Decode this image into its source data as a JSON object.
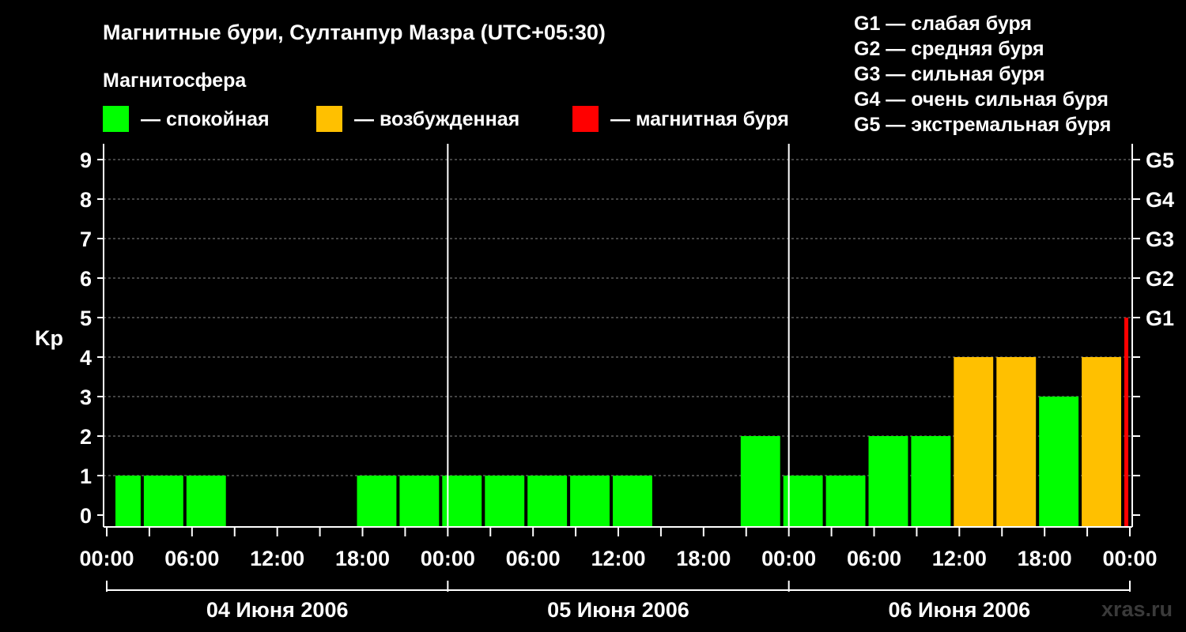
{
  "chart_data": {
    "type": "bar",
    "title": "Магнитные бури, Султанпур Мазра (UTC+05:30)",
    "ylabel": "Kp",
    "ylim": [
      0,
      9
    ],
    "yticks": [
      "0",
      "1",
      "2",
      "3",
      "4",
      "5",
      "6",
      "7",
      "8",
      "9"
    ],
    "xticks": [
      "00:00",
      "06:00",
      "12:00",
      "18:00",
      "00:00",
      "06:00",
      "12:00",
      "18:00",
      "00:00",
      "06:00",
      "12:00",
      "18:00",
      "00:00"
    ],
    "days": [
      "04 Июня 2006",
      "05 Июня 2006",
      "06 Июня 2006"
    ],
    "grid": "horizontal dashed",
    "legend": {
      "heading": "Магнитосфера",
      "items": [
        {
          "label": "— спокойная",
          "color": "#00ff00"
        },
        {
          "label": "— возбужденная",
          "color": "#ffc000"
        },
        {
          "label": "— магнитная буря",
          "color": "#ff0000"
        }
      ]
    },
    "storm_scale": [
      {
        "level": "G1",
        "kp": 5,
        "desc": "G1 — слабая буря"
      },
      {
        "level": "G2",
        "kp": 6,
        "desc": "G2 — средняя буря"
      },
      {
        "level": "G3",
        "kp": 7,
        "desc": "G3 — сильная буря"
      },
      {
        "level": "G4",
        "kp": 8,
        "desc": "G4 — очень сильная буря"
      },
      {
        "level": "G5",
        "kp": 9,
        "desc": "G5 — экстремальная буря"
      }
    ],
    "bars": [
      {
        "start": "04 Июня 2006 00:30",
        "end": "04 Июня 2006 02:30",
        "kp": 1,
        "status": "спокойная"
      },
      {
        "start": "04 Июня 2006 02:30",
        "end": "04 Июня 2006 05:30",
        "kp": 1,
        "status": "спокойная"
      },
      {
        "start": "04 Июня 2006 05:30",
        "end": "04 Июня 2006 08:30",
        "kp": 1,
        "status": "спокойная"
      },
      {
        "start": "04 Июня 2006 17:30",
        "end": "04 Июня 2006 20:30",
        "kp": 1,
        "status": "спокойная"
      },
      {
        "start": "04 Июня 2006 20:30",
        "end": "04 Июня 2006 23:30",
        "kp": 1,
        "status": "спокойная"
      },
      {
        "start": "04 Июня 2006 23:30",
        "end": "05 Июня 2006 02:30",
        "kp": 1,
        "status": "спокойная"
      },
      {
        "start": "05 Июня 2006 02:30",
        "end": "05 Июня 2006 05:30",
        "kp": 1,
        "status": "спокойная"
      },
      {
        "start": "05 Июня 2006 05:30",
        "end": "05 Июня 2006 08:30",
        "kp": 1,
        "status": "спокойная"
      },
      {
        "start": "05 Июня 2006 08:30",
        "end": "05 Июня 2006 11:30",
        "kp": 1,
        "status": "спокойная"
      },
      {
        "start": "05 Июня 2006 11:30",
        "end": "05 Июня 2006 14:30",
        "kp": 1,
        "status": "спокойная"
      },
      {
        "start": "05 Июня 2006 20:30",
        "end": "05 Июня 2006 23:30",
        "kp": 2,
        "status": "спокойная"
      },
      {
        "start": "05 Июня 2006 23:30",
        "end": "06 Июня 2006 02:30",
        "kp": 1,
        "status": "спокойная"
      },
      {
        "start": "06 Июня 2006 02:30",
        "end": "06 Июня 2006 05:30",
        "kp": 1,
        "status": "спокойная"
      },
      {
        "start": "06 Июня 2006 05:30",
        "end": "06 Июня 2006 08:30",
        "kp": 2,
        "status": "спокойная"
      },
      {
        "start": "06 Июня 2006 08:30",
        "end": "06 Июня 2006 11:30",
        "kp": 2,
        "status": "спокойная"
      },
      {
        "start": "06 Июня 2006 11:30",
        "end": "06 Июня 2006 14:30",
        "kp": 4,
        "status": "возбужденная"
      },
      {
        "start": "06 Июня 2006 14:30",
        "end": "06 Июня 2006 17:30",
        "kp": 4,
        "status": "возбужденная"
      },
      {
        "start": "06 Июня 2006 17:30",
        "end": "06 Июня 2006 20:30",
        "kp": 3,
        "status": "спокойная"
      },
      {
        "start": "06 Июня 2006 20:30",
        "end": "06 Июня 2006 23:30",
        "kp": 4,
        "status": "возбужденная"
      },
      {
        "start": "06 Июня 2006 23:30",
        "end": "07 Июня 2006 00:00",
        "kp": 5,
        "status": "магнитная буря"
      }
    ],
    "watermark": "xras.ru"
  }
}
